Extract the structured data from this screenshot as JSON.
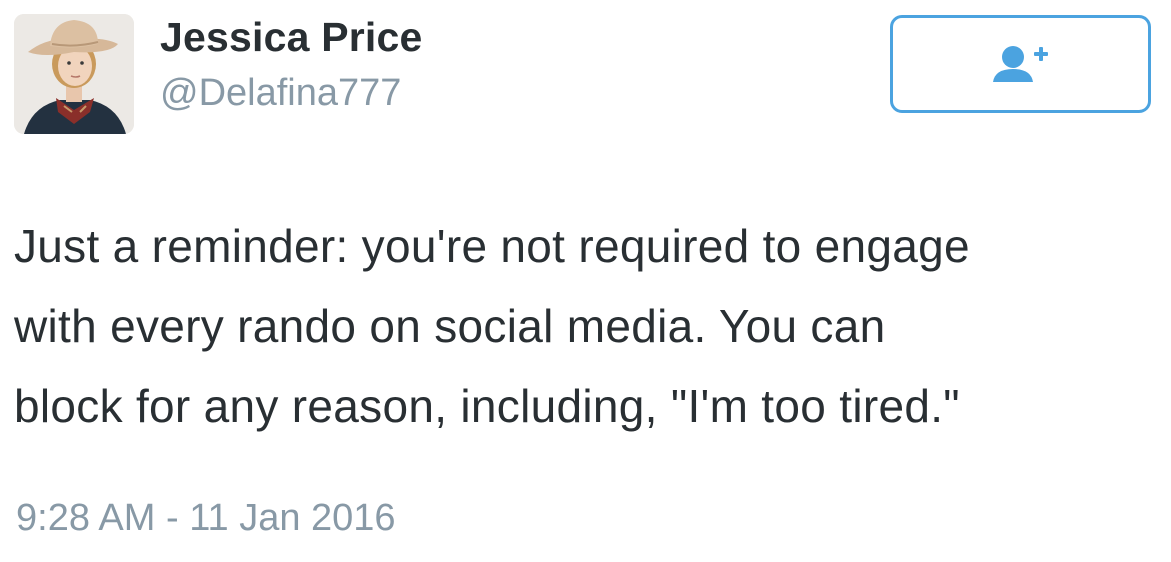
{
  "user": {
    "display_name": "Jessica Price",
    "handle": "@Delafina777"
  },
  "follow_button": {
    "icon": "follow-user-plus-icon",
    "accent_color": "#4ba3e0"
  },
  "tweet": {
    "lines": [
      "Just a reminder: you're not required to engage",
      "with every rando on social media. You can",
      "block for any reason, including, \"I'm too tired.\""
    ],
    "timestamp": "9:28 AM - 11 Jan 2016"
  },
  "colors": {
    "text": "#292f33",
    "muted": "#8899a6"
  }
}
